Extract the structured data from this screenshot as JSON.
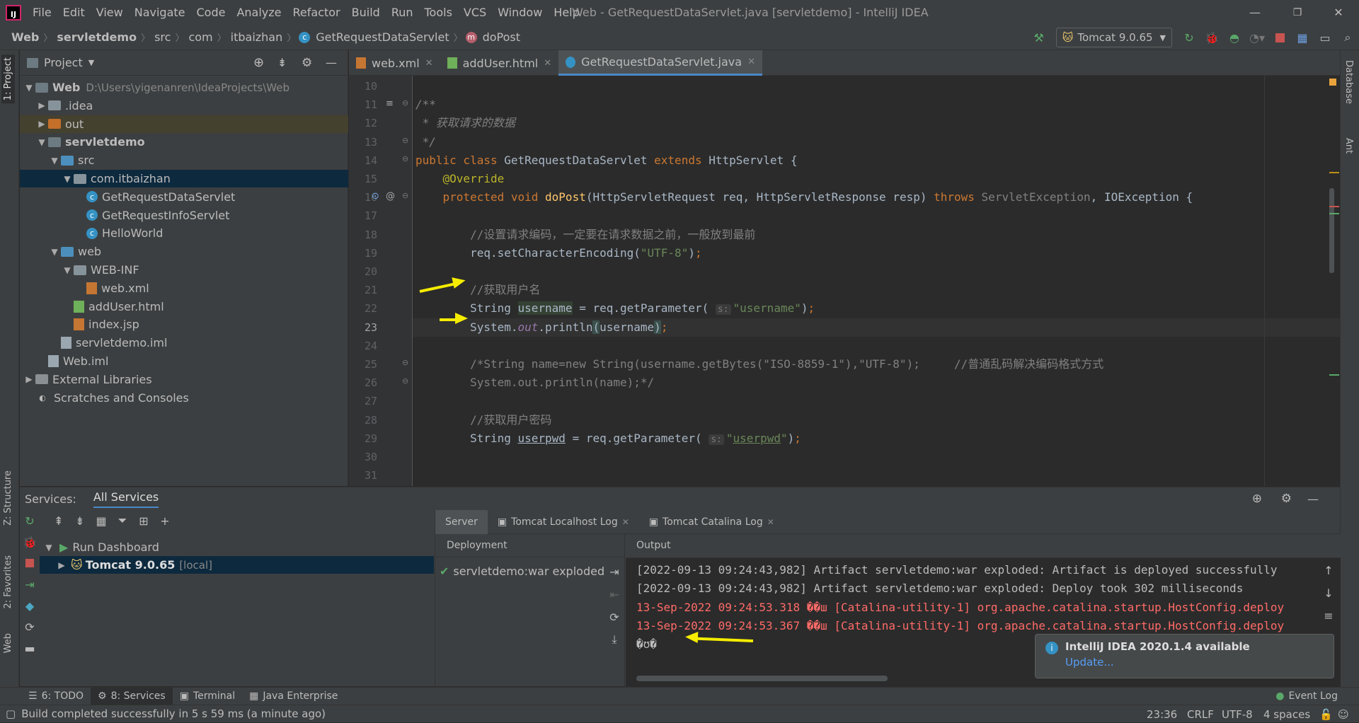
{
  "window": {
    "title": "Web - GetRequestDataServlet.java [servletdemo] - IntelliJ IDEA",
    "app_icon": "IJ",
    "menu": [
      "File",
      "Edit",
      "View",
      "Navigate",
      "Code",
      "Analyze",
      "Refactor",
      "Build",
      "Run",
      "Tools",
      "VCS",
      "Window",
      "Help"
    ],
    "controls": {
      "minimize": "—",
      "restore": "❐",
      "close": "✕"
    }
  },
  "breadcrumb": [
    "Web",
    "servletdemo",
    "src",
    "com",
    "itbaizhan",
    "GetRequestDataServlet",
    "doPost"
  ],
  "toolbar": {
    "run_config": "Tomcat 9.0.65"
  },
  "tool_strips": {
    "left": [
      "1: Project",
      "Z: Structure",
      "2: Favorites",
      "Web"
    ],
    "right": [
      "Database",
      "Ant"
    ]
  },
  "project": {
    "title": "Project",
    "tree": [
      {
        "label": "Web",
        "extra": "D:\\Users\\yigenanren\\IdeaProjects\\Web",
        "depth": 0,
        "arrow": "▼",
        "icon": "folder-dark",
        "bold": true
      },
      {
        "label": ".idea",
        "depth": 1,
        "arrow": "▶",
        "icon": "folder"
      },
      {
        "label": "out",
        "depth": 1,
        "arrow": "▶",
        "icon": "folder-orange",
        "state": "hl"
      },
      {
        "label": "servletdemo",
        "depth": 1,
        "arrow": "▼",
        "icon": "folder-dark",
        "bold": true
      },
      {
        "label": "src",
        "depth": 2,
        "arrow": "▼",
        "icon": "folder-blue"
      },
      {
        "label": "com.itbaizhan",
        "depth": 3,
        "arrow": "▼",
        "icon": "folder",
        "state": "selected"
      },
      {
        "label": "GetRequestDataServlet",
        "depth": 4,
        "arrow": "",
        "icon": "class"
      },
      {
        "label": "GetRequestInfoServlet",
        "depth": 4,
        "arrow": "",
        "icon": "class"
      },
      {
        "label": "HelloWorld",
        "depth": 4,
        "arrow": "",
        "icon": "class"
      },
      {
        "label": "web",
        "depth": 2,
        "arrow": "▼",
        "icon": "folder-blue"
      },
      {
        "label": "WEB-INF",
        "depth": 3,
        "arrow": "▼",
        "icon": "folder"
      },
      {
        "label": "web.xml",
        "depth": 4,
        "arrow": "",
        "icon": "xml"
      },
      {
        "label": "addUser.html",
        "depth": 3,
        "arrow": "",
        "icon": "html"
      },
      {
        "label": "index.jsp",
        "depth": 3,
        "arrow": "",
        "icon": "jsp"
      },
      {
        "label": "servletdemo.iml",
        "depth": 2,
        "arrow": "",
        "icon": "file"
      },
      {
        "label": "Web.iml",
        "depth": 1,
        "arrow": "",
        "icon": "file"
      },
      {
        "label": "External Libraries",
        "depth": 0,
        "arrow": "▶",
        "icon": "lib"
      },
      {
        "label": "Scratches and Consoles",
        "depth": 0,
        "arrow": "",
        "icon": "scratch"
      }
    ]
  },
  "editor": {
    "tabs": [
      {
        "label": "web.xml",
        "active": false
      },
      {
        "label": "addUser.html",
        "active": false
      },
      {
        "label": "GetRequestDataServlet.java",
        "active": true
      }
    ],
    "current_line": 23,
    "lines": [
      {
        "n": 10,
        "html": ""
      },
      {
        "n": 11,
        "html": "<span class='cmt'>/**</span>"
      },
      {
        "n": 12,
        "html": "<span class='cmt'> * 获取请求的数据</span>"
      },
      {
        "n": 13,
        "html": "<span class='cmt'> */</span>"
      },
      {
        "n": 14,
        "html": "<span class='kw'>public class </span>GetRequestDataServlet <span class='kw'>extends </span>HttpServlet {"
      },
      {
        "n": 15,
        "html": "    <span class='ann'>@Override</span>"
      },
      {
        "n": 16,
        "html": "    <span class='kw'>protected void </span><span class='fn'>doPost</span>(HttpServletRequest req, HttpServletResponse resp) <span class='kw'>throws </span><span style='color:#808080'>ServletException</span>, IOException {"
      },
      {
        "n": 17,
        "html": ""
      },
      {
        "n": 18,
        "html": "        <span class='lc'>//设置请求编码，一定要在请求数据之前，一般放到最前</span>"
      },
      {
        "n": 19,
        "html": "        req.setCharacterEncoding(<span class='str'>\"UTF-8\"</span>)<span class='kw'>;</span>"
      },
      {
        "n": 20,
        "html": ""
      },
      {
        "n": 21,
        "html": "        <span class='lc'>//获取用户名</span>"
      },
      {
        "n": 22,
        "html": "        String <span style='background:#344134'>username</span> = req.getParameter( <span class='hint'>s:</span><span class='str'>\"username\"</span>)<span class='kw'>;</span>"
      },
      {
        "n": 23,
        "html": "        System.<span class='fld'>out</span>.println<span style='background:#3b514d'>(</span>username<span style='background:#3b514d'>)</span><span class='kw'>;</span>"
      },
      {
        "n": 24,
        "html": ""
      },
      {
        "n": 25,
        "html": "        <span class='lc'>/*String name=new String(username.getBytes(\"ISO-8859-1\"),\"UTF-8\");     //普通乱码解决编码格式方式</span>"
      },
      {
        "n": 26,
        "html": "<span class='lc'>        System.out.println(name);*/</span>"
      },
      {
        "n": 27,
        "html": ""
      },
      {
        "n": 28,
        "html": "        <span class='lc'>//获取用户密码</span>"
      },
      {
        "n": 29,
        "html": "        String <span style='text-decoration:underline'>userpwd</span> = req.getParameter( <span class='hint'>s:</span><span class='str'>\"<u>userpwd</u>\"</span>)<span class='kw'>;</span>"
      },
      {
        "n": 30,
        "html": ""
      },
      {
        "n": 31,
        "html": ""
      }
    ]
  },
  "services": {
    "title": "Services:",
    "scope": "All Services",
    "tree": [
      {
        "label": "Run Dashboard",
        "extra": ""
      },
      {
        "label": "Tomcat 9.0.65",
        "extra": "[local]"
      }
    ],
    "tabs": [
      "Server",
      "Tomcat Localhost Log",
      "Tomcat Catalina Log"
    ],
    "deployment_header": "Deployment",
    "output_header": "Output",
    "deployment_item": "servletdemo:war exploded",
    "log": [
      {
        "text": "[2022-09-13 09:24:43,982] Artifact servletdemo:war exploded: Artifact is deployed successfully",
        "color": "#bbbbbb"
      },
      {
        "text": "[2022-09-13 09:24:43,982] Artifact servletdemo:war exploded: Deploy took 302 milliseconds",
        "color": "#bbbbbb"
      },
      {
        "text": "13-Sep-2022 09:24:53.318 ��ш [Catalina-utility-1] org.apache.catalina.startup.HostConfig.deploy",
        "color": "#ff6b68"
      },
      {
        "text": "13-Sep-2022 09:24:53.367 ��ш [Catalina-utility-1] org.apache.catalina.startup.HostConfig.deploy",
        "color": "#ff6b68"
      },
      {
        "text": "�ʊ�",
        "color": "#bbbbbb"
      }
    ]
  },
  "notification": {
    "title": "IntelliJ IDEA 2020.1.4 available",
    "link": "Update..."
  },
  "bottom_tabs": [
    "6: TODO",
    "8: Services",
    "Terminal",
    "Java Enterprise"
  ],
  "event_log": "Event Log",
  "status": {
    "message": "Build completed successfully in 5 s 59 ms (a minute ago)",
    "position": "23:36",
    "line_sep": "CRLF",
    "encoding": "UTF-8",
    "indent": "4 spaces"
  }
}
